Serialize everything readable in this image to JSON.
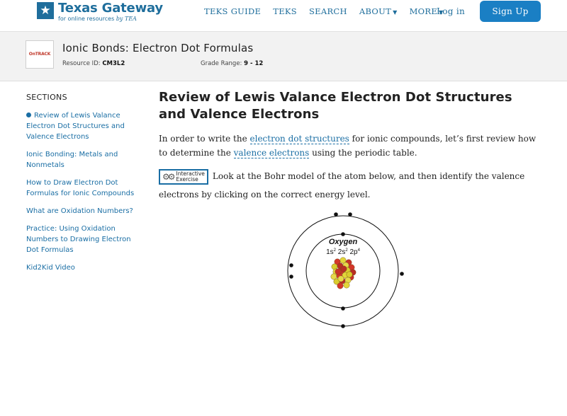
{
  "brand": {
    "title": "Texas Gateway",
    "subtitle": "for online resources",
    "subtitle_by": "by TEA"
  },
  "nav": {
    "links": [
      "TEKS GUIDE",
      "TEKS",
      "SEARCH",
      "ABOUT",
      "MORE"
    ],
    "login": "Log in",
    "signup": "Sign Up"
  },
  "resource": {
    "thumb_brand": "OnTRACK",
    "title": "Ionic Bonds: Electron Dot Formulas",
    "id_label": "Resource ID:",
    "id_value": "CM3L2",
    "grade_label": "Grade Range:",
    "grade_value": "9 - 12"
  },
  "sidebar": {
    "heading": "SECTIONS",
    "items": [
      {
        "label": "Review of Lewis Valance Electron Dot Structures and Valence Electrons",
        "active": true
      },
      {
        "label": "Ionic Bonding: Metals and Nonmetals",
        "active": false
      },
      {
        "label": "How to Draw Electron Dot Formulas for Ionic Compounds",
        "active": false
      },
      {
        "label": "What are Oxidation Numbers?",
        "active": false
      },
      {
        "label": "Practice: Using Oxidation Numbers to Drawing Electron Dot Formulas",
        "active": false
      },
      {
        "label": "Kid2Kid Video",
        "active": false
      }
    ]
  },
  "content": {
    "heading": "Review of Lewis Valance Electron Dot Structures and Valence Electrons",
    "para1_a": "In order to write the ",
    "para1_link1": "electron dot structures",
    "para1_b": " for ionic compounds, let’s first review how to determine the ",
    "para1_link2": "valence electrons",
    "para1_c": " using the periodic table.",
    "badge_line1": "Interactive",
    "badge_line2": "Exercise",
    "para2": "Look at the Bohr model of the atom below, and then identify the valence electrons by clicking on the correct energy level.",
    "atom": {
      "name": "Oxygen",
      "config": "1s2 2s2 2p4"
    }
  },
  "colors": {
    "brand_blue": "#1f6e9c",
    "link_blue": "#1a6ea4",
    "signup_bg": "#1a7fc4"
  }
}
